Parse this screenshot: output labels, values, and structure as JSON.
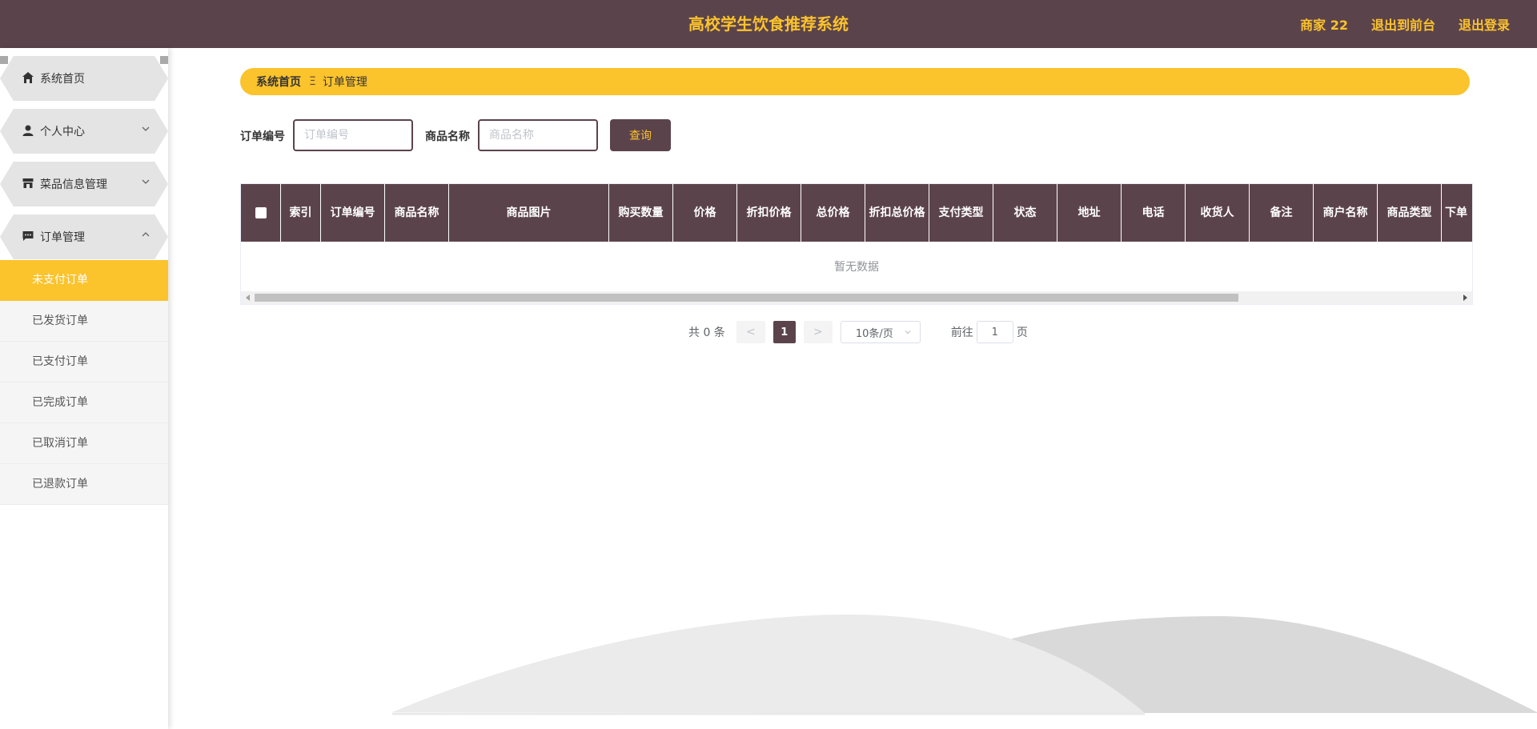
{
  "header": {
    "title": "高校学生饮食推荐系统",
    "user": "商家 22",
    "to_front": "退出到前台",
    "logout": "退出登录"
  },
  "sidebar": {
    "items": [
      {
        "label": "系统首页",
        "icon": "home-icon"
      },
      {
        "label": "个人中心",
        "icon": "user-icon"
      },
      {
        "label": "菜品信息管理",
        "icon": "shop-icon"
      },
      {
        "label": "订单管理",
        "icon": "chat-icon",
        "expanded": true
      }
    ],
    "subitems": [
      {
        "label": "未支付订单",
        "active": true
      },
      {
        "label": "已发货订单"
      },
      {
        "label": "已支付订单"
      },
      {
        "label": "已完成订单"
      },
      {
        "label": "已取消订单"
      },
      {
        "label": "已退款订单"
      }
    ]
  },
  "breadcrumb": {
    "home": "系统首页",
    "sep": "Ξ",
    "current": "订单管理"
  },
  "search": {
    "order_no_label": "订单编号",
    "order_no_placeholder": "订单编号",
    "order_no_value": "",
    "goods_name_label": "商品名称",
    "goods_name_placeholder": "商品名称",
    "goods_name_value": "",
    "query_label": "查询"
  },
  "table": {
    "columns": [
      "索引",
      "订单编号",
      "商品名称",
      "商品图片",
      "购买数量",
      "价格",
      "折扣价格",
      "总价格",
      "折扣总价格",
      "支付类型",
      "状态",
      "地址",
      "电话",
      "收货人",
      "备注",
      "商户名称",
      "商品类型",
      "下单"
    ],
    "empty_text": "暂无数据"
  },
  "pagination": {
    "total": "共 0 条",
    "prev": "<",
    "current": "1",
    "next": ">",
    "page_size": "10条/页",
    "goto_label": "前往",
    "goto_value": "1",
    "page_suffix": "页"
  },
  "colors": {
    "brand": "#5b434c",
    "accent": "#fbc32c"
  }
}
